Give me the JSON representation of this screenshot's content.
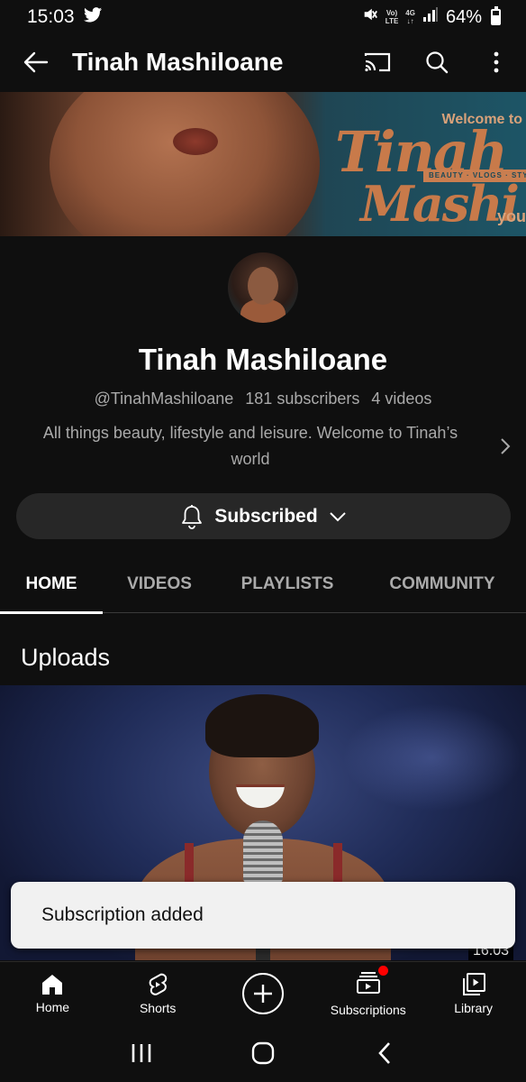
{
  "status_bar": {
    "time": "15:03",
    "network_top": "Vo)",
    "network_bottom": "LTE",
    "net_type": "4G",
    "battery": "64%",
    "battery_level": 0.64
  },
  "app_bar": {
    "title": "Tinah Mashiloane"
  },
  "banner": {
    "welcome": "Welcome to",
    "name_line1": "Tinah",
    "name_line2": "Mashi",
    "tags": "BEAUTY · VLOGS · STY",
    "tail": "you"
  },
  "channel": {
    "name": "Tinah Mashiloane",
    "handle": "@TinahMashiloane",
    "subscribers": "181 subscribers",
    "videos": "4 videos",
    "description": "All things beauty, lifestyle and leisure. Welcome to Tinah’s world"
  },
  "subscribe": {
    "label": "Subscribed"
  },
  "tabs": [
    {
      "label": "HOME",
      "active": true
    },
    {
      "label": "VIDEOS",
      "active": false
    },
    {
      "label": "PLAYLISTS",
      "active": false
    },
    {
      "label": "COMMUNITY",
      "active": false
    }
  ],
  "uploads": {
    "title": "Uploads",
    "duration": "16:03"
  },
  "toast": {
    "text": "Subscription added"
  },
  "bottom_nav": [
    {
      "label": "Home",
      "icon": "home-icon"
    },
    {
      "label": "Shorts",
      "icon": "shorts-icon"
    },
    {
      "label": "",
      "icon": "create-icon"
    },
    {
      "label": "Subscriptions",
      "icon": "subscriptions-icon"
    },
    {
      "label": "Library",
      "icon": "library-icon"
    }
  ],
  "colors": {
    "background": "#0f0f0f",
    "accent_red": "#ff0000",
    "toast_bg": "#f1f1f1",
    "button_bg": "#272727"
  }
}
